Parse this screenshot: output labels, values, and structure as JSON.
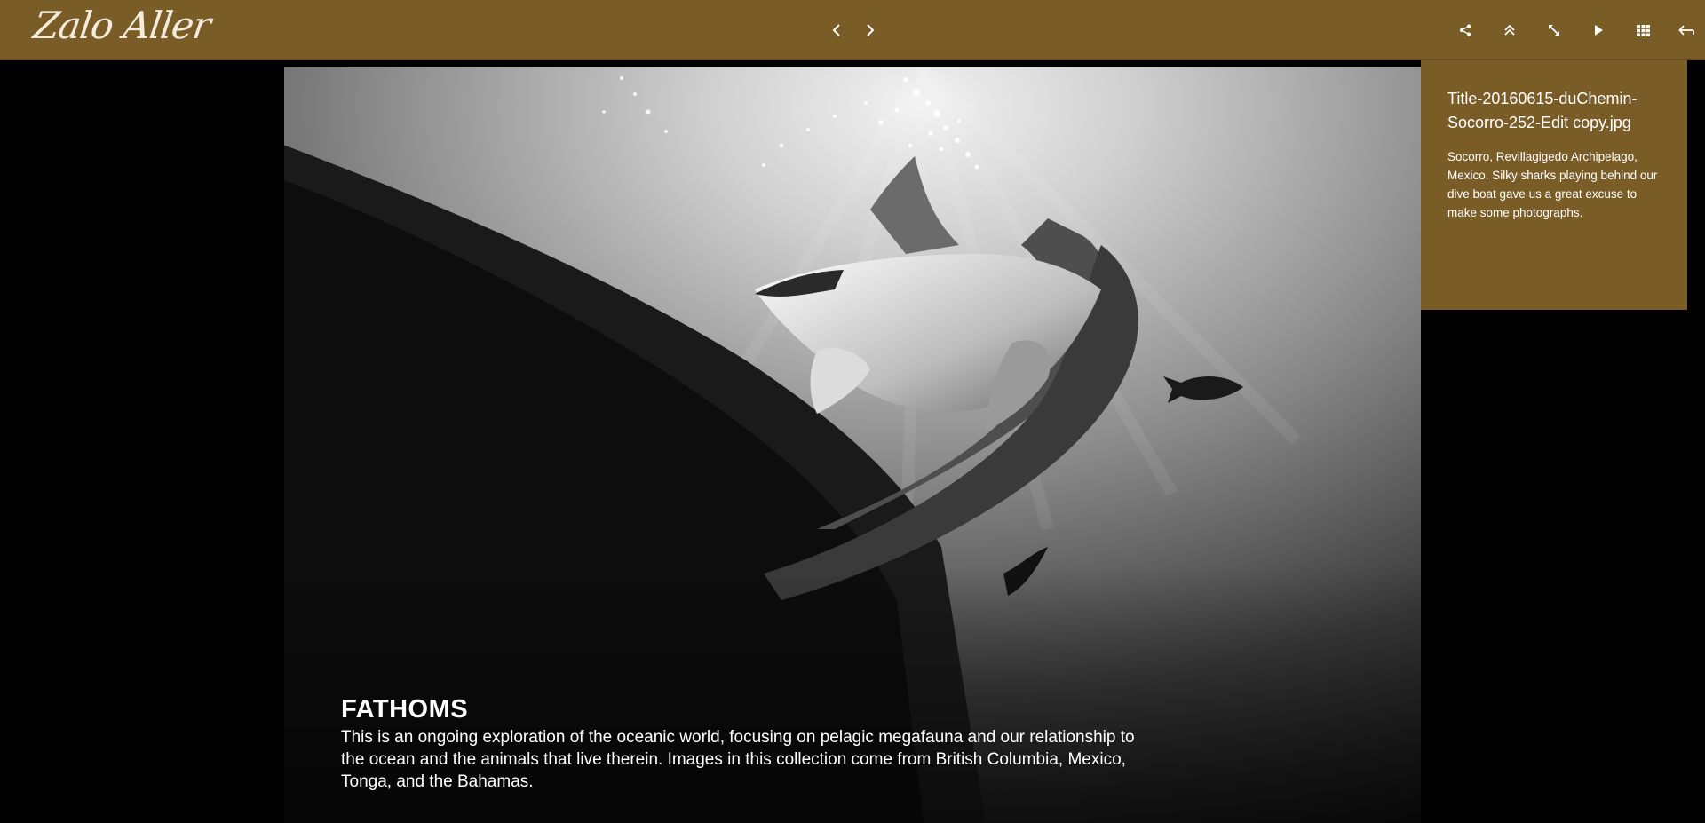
{
  "header": {
    "logo_text": "Zalo Aller",
    "background_color": "#7a5c27",
    "prev_icon": "chevron-left-icon",
    "next_icon": "chevron-right-icon",
    "toolbar_icons": [
      "share-icon",
      "double-chevron-up-icon",
      "expand-icon",
      "play-icon",
      "grid-icon",
      "back-arrow-icon"
    ]
  },
  "collection": {
    "title": "FATHOMS",
    "description": "This is an ongoing exploration of the oceanic world, focusing on pelagic megafauna and our relationship to the ocean and the animals that live therein. Images in this collection come from British Columbia, Mexico, Tonga, and the Bahamas."
  },
  "info_panel": {
    "filename": "Title-20160615-duChemin-Socorro-252-Edit copy.jpg",
    "description": "Socorro, Revillagigedo Archipelago, Mexico. Silky sharks playing behind our dive boat gave us a great excuse to make some photographs."
  }
}
